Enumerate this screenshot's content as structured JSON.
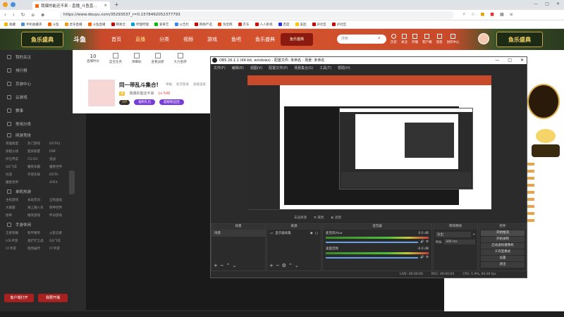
{
  "browser": {
    "tab_title": "我爆的能还不来 - 直播_斗鱼直...",
    "url": "https://www.douyu.com/35293537_r=0.1578492052377793"
  },
  "bookmarks": [
    "收藏",
    "手机收藏夹",
    "斗鱼",
    "虎牙直播",
    "斗鱼直播",
    "网易云",
    "哔哩哔哩",
    "爱奇艺",
    "公告栏",
    "网易严选",
    "淘宝网",
    "京东",
    "人人影视",
    "百度",
    "美团",
    "JR社区",
    "JR社区"
  ],
  "site": {
    "logo": "斗鱼",
    "nav": [
      "首页",
      "直播",
      "分类",
      "视频",
      "游戏",
      "鱼吧",
      "鱼乐盛典"
    ],
    "search_placeholder": "搜索",
    "badge": "鱼乐盛典",
    "right_icons": [
      "历史",
      "关注",
      "开播",
      "客户端",
      "消息",
      "创作中心"
    ]
  },
  "sidebar": {
    "items": [
      "我的关注",
      "排行榜",
      "页游中心",
      "云游戏",
      "赛事",
      "常用分类"
    ],
    "section1": "网游竞技",
    "grid1": [
      "英雄联盟",
      "热门游戏",
      "DOTA2",
      "穿越火线",
      "超高质量",
      "DNF",
      "炉石传说",
      "CS:GO",
      "逃战",
      "QQ飞车",
      "魔兽争霸",
      "魔兽世界",
      "问道",
      "守望先锋",
      "DOTA",
      "魔兽世界",
      "",
      "APEX"
    ],
    "section2": "单机热游",
    "grid2": [
      "主机游戏",
      "永劫无间",
      "全民国战",
      "大家都",
      "海上跳人舟",
      "原神世界",
      "原神",
      "精英游戏",
      "怀旧游戏"
    ],
    "section3": "手游休闲",
    "grid3": [
      "王者荣耀",
      "和平精英",
      "火影忍者",
      "LOL手游",
      "金铲铲之战",
      "QQ飞车",
      "CF手游",
      "暗黑破坏",
      "CF手游"
    ],
    "btn1": "客户端打开",
    "btn2": "我要开播"
  },
  "room": {
    "stats": [
      "10",
      "直播时长",
      "蓝宝任务",
      "弹幕助",
      "查看战绩",
      "大力金牌"
    ],
    "title": "同一带乱斗集合!",
    "streamer": "我爆的能还不来",
    "fans": "Lv 546",
    "tags": [
      "举报",
      "初次登录",
      "高级道具"
    ],
    "buttons": [
      "VIP",
      "福利礼包",
      "超级粉丝团"
    ]
  },
  "obs": {
    "title": "OBS 26.1.1 (64-bit, windows) - 配置文件: 未命名 - 场景: 未命名",
    "menu": [
      "文件(F)",
      "编辑(E)",
      "视图(V)",
      "配置文件(P)",
      "场景集合(S)",
      "工具(T)",
      "帮助(H)"
    ],
    "docks": {
      "scenes": "场景",
      "sources": "来源",
      "mixer": "混音器",
      "transitions": "转场特效",
      "controls": "控件"
    },
    "scene_item": "场景",
    "source_item": "显示器采集",
    "mixer_tracks": [
      {
        "name": "桌面音频",
        "level": "-0.0 dB"
      },
      {
        "name": "麦克风/Aux",
        "level": "0.0 dB"
      }
    ],
    "transition": {
      "type": "淡出",
      "duration_label": "时长",
      "duration": "300 ms"
    },
    "controls": [
      "开始推流",
      "开始录制",
      "启动虚拟摄像机",
      "工作室模式",
      "设置",
      "退出"
    ],
    "status": {
      "live": "LIVE: 00:00:00",
      "rec": "REC: 00:00:00",
      "cpu": "CPU: 1.9%, 60.00 fps"
    },
    "preview_label": "未选择源",
    "props": "属性",
    "filters": "滤镜"
  }
}
